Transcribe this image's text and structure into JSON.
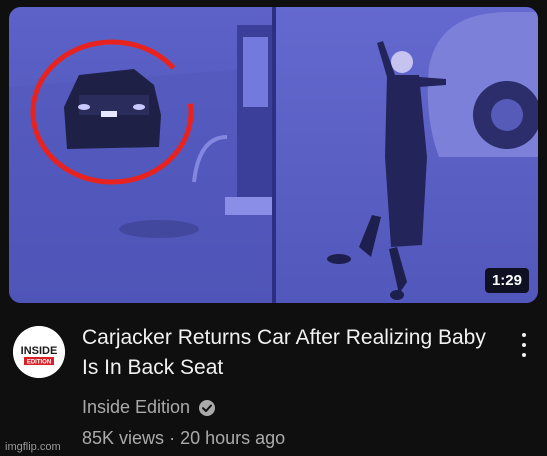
{
  "video": {
    "duration": "1:29",
    "title": "Carjacker Returns Car After Realizing Baby Is In Back Seat",
    "channel": "Inside Edition",
    "views": "85K views",
    "separator": "·",
    "age": "20 hours ago"
  },
  "avatar": {
    "line1": "INSIDE",
    "line2": "EDITION"
  },
  "icons": {
    "verified": "check-circle-icon",
    "menu": "kebab-menu-icon"
  },
  "watermark": "imgflip.com",
  "colors": {
    "background": "#0f0f0f",
    "thumbnail_tint": "#4f54b8",
    "circle_highlight": "#e8231f",
    "avatar_red": "#d81f26"
  }
}
